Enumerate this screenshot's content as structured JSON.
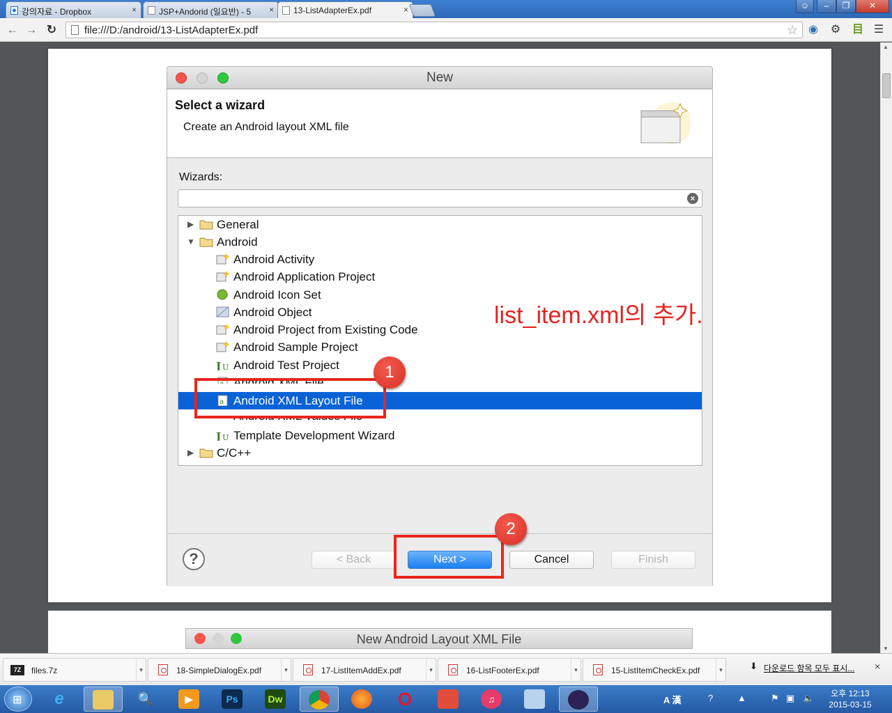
{
  "browser": {
    "tabs": [
      {
        "label": "강의자료 - Dropbox"
      },
      {
        "label": "JSP+Andorid (일요반) - 5"
      },
      {
        "label": "13-ListAdapterEx.pdf"
      }
    ],
    "url": "file:///D:/android/13-ListAdapterEx.pdf"
  },
  "dialog": {
    "title": "New",
    "header_title": "Select a wizard",
    "header_subtitle": "Create an Android layout XML file",
    "wizards_label": "Wizards:",
    "filter_value": "",
    "tree": [
      {
        "label": "General",
        "level": 0,
        "expanded": false,
        "icon": "folder-icon"
      },
      {
        "label": "Android",
        "level": 0,
        "expanded": true,
        "icon": "folder-icon"
      },
      {
        "label": "Android Activity",
        "level": 1,
        "icon": "android-wizard-icon"
      },
      {
        "label": "Android Application Project",
        "level": 1,
        "icon": "android-wizard-icon"
      },
      {
        "label": "Android Icon Set",
        "level": 1,
        "icon": "icon-set-icon"
      },
      {
        "label": "Android Object",
        "level": 1,
        "icon": "object-icon"
      },
      {
        "label": "Android Project from Existing Code",
        "level": 1,
        "icon": "android-wizard-icon"
      },
      {
        "label": "Android Sample Project",
        "level": 1,
        "icon": "android-wizard-icon"
      },
      {
        "label": "Android Test Project",
        "level": 1,
        "icon": "junit-icon"
      },
      {
        "label": "Android XML File",
        "level": 1,
        "icon": "xml-file-icon"
      },
      {
        "label": "Android XML Layout File",
        "level": 1,
        "icon": "xml-file-icon",
        "selected": true
      },
      {
        "label": "Android XML Values File",
        "level": 1,
        "icon": "xml-file-icon"
      },
      {
        "label": "Template Development Wizard",
        "level": 1,
        "icon": "junit-icon"
      },
      {
        "label": "C/C++",
        "level": 0,
        "expanded": false,
        "icon": "folder-icon"
      }
    ],
    "buttons": {
      "back": "< Back",
      "next": "Next >",
      "cancel": "Cancel",
      "finish": "Finish"
    }
  },
  "annotations": {
    "note": "list_item.xml의 추가.",
    "badge1": "1",
    "badge2": "2",
    "highlight_color": "#e8261c"
  },
  "page2": {
    "dialog_title": "New Android Layout XML File"
  },
  "downloads": {
    "items": [
      "files.7z",
      "18-SimpleDialogEx.pdf",
      "17-ListItemAddEx.pdf",
      "16-ListFooterEx.pdf",
      "15-ListItemCheckEx.pdf"
    ],
    "show_all": "다운로드 항목 모두 표시..."
  },
  "taskbar": {
    "clock_time": "오후 12:13",
    "clock_date": "2015-03-15",
    "ime": "A 漢"
  },
  "colors": {
    "selection": "#0a63d6",
    "primary_button": "#1b7ef0",
    "taskbar": "#2d66b0"
  }
}
